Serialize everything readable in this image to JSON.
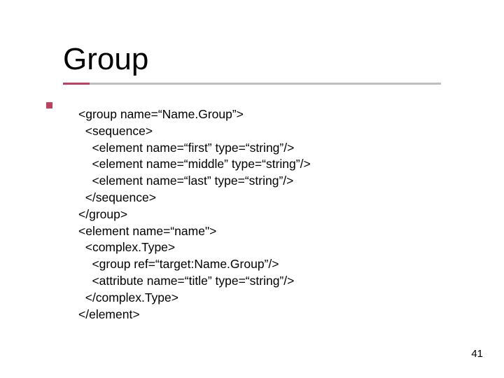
{
  "title": "Group",
  "code": {
    "l1": "<group name=“Name.Group”>",
    "l2": "  <sequence>",
    "l3": "    <element name=“first” type=“string”/>",
    "l4": "    <element name=“middle” type=“string”/>",
    "l5": "    <element name=“last” type=“string”/>",
    "l6": "  </sequence>",
    "l7": "</group>",
    "l8": "<element name=“name\">",
    "l9": "  <complex.Type>",
    "l10": "    <group ref=“target:Name.Group”/>",
    "l11": "    <attribute name=“title” type=“string”/>",
    "l12": "  </complex.Type>",
    "l13": "</element>"
  },
  "page_number": "41"
}
